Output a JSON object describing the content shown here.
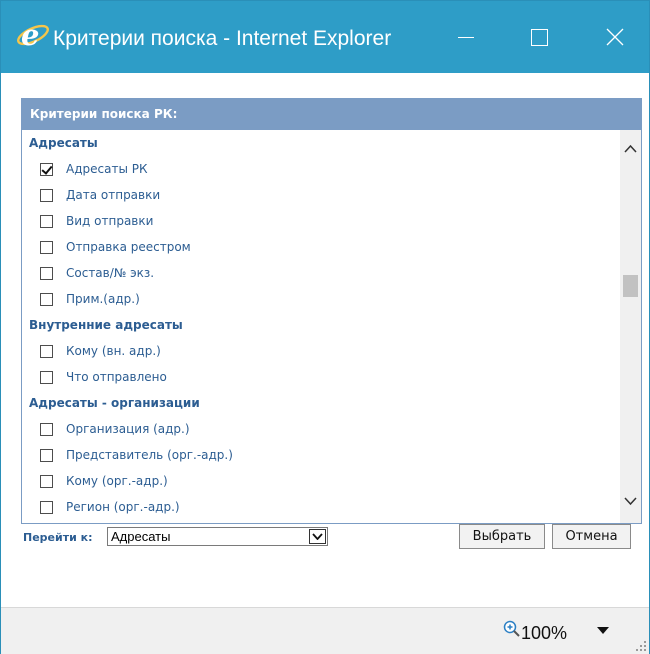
{
  "window": {
    "title": "Критерии поиска - Internet Explorer",
    "titlebar_color": "#2e9dc7"
  },
  "panel": {
    "header": "Критерии поиска РК:",
    "groups": [
      {
        "label": "Адресаты",
        "items": [
          {
            "label": "Адресаты РК",
            "checked": true
          },
          {
            "label": "Дата отправки",
            "checked": false
          },
          {
            "label": "Вид отправки",
            "checked": false
          },
          {
            "label": "Отправка реестром",
            "checked": false
          },
          {
            "label": "Состав/№ экз.",
            "checked": false
          },
          {
            "label": "Прим.(адр.)",
            "checked": false
          }
        ]
      },
      {
        "label": "Внутренние адресаты",
        "items": [
          {
            "label": "Кому (вн. адр.)",
            "checked": false
          },
          {
            "label": "Что отправлено",
            "checked": false
          }
        ]
      },
      {
        "label": "Адресаты - организации",
        "items": [
          {
            "label": "Организация (адр.)",
            "checked": false
          },
          {
            "label": "Представитель (орг.-адр.)",
            "checked": false
          },
          {
            "label": "Кому (орг.-адр.)",
            "checked": false
          },
          {
            "label": "Регион (орг.-адр.)",
            "checked": false
          }
        ]
      }
    ]
  },
  "footer": {
    "goto_label": "Перейти к:",
    "goto_value": "Адресаты",
    "select_button": "Выбрать",
    "cancel_button": "Отмена"
  },
  "statusbar": {
    "zoom": "100%"
  },
  "icons": {
    "app": "ie-logo-icon",
    "minimize": "minimize-icon",
    "maximize": "maximize-icon",
    "close": "close-icon",
    "zoom": "zoom-in-icon",
    "dropdown": "chevron-down-icon"
  }
}
